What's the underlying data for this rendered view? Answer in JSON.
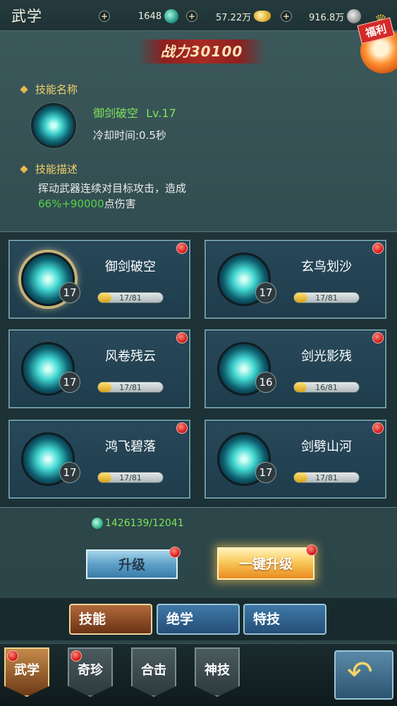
{
  "header": {
    "title": "武学",
    "jade": "1648",
    "gold": "57.22万",
    "coins": "916.8万",
    "welfare": "福利"
  },
  "power": {
    "label": "战力30100"
  },
  "selected_skill": {
    "name_label": "技能名称",
    "name": "御剑破空",
    "level": "Lv.17",
    "cooldown": "冷却时间:0.5秒",
    "desc_label": "技能描述",
    "desc_line1": "挥动武器连续对目标攻击，造成",
    "desc_damage": "66%+90000",
    "desc_suffix": "点伤害"
  },
  "skills": [
    {
      "name": "御剑破空",
      "level": "17",
      "progress": "17/81",
      "progress_value": 0.21
    },
    {
      "name": "玄鸟划沙",
      "level": "17",
      "progress": "17/81",
      "progress_value": 0.21
    },
    {
      "name": "风卷残云",
      "level": "17",
      "progress": "17/81",
      "progress_value": 0.21
    },
    {
      "name": "剑光影残",
      "level": "16",
      "progress": "16/81",
      "progress_value": 0.2
    },
    {
      "name": "鸿飞碧落",
      "level": "17",
      "progress": "17/81",
      "progress_value": 0.21
    },
    {
      "name": "剑劈山河",
      "level": "17",
      "progress": "17/81",
      "progress_value": 0.21
    }
  ],
  "exp": "1426139/12041",
  "buttons": {
    "upgrade": "升级",
    "upgrade_all": "一键升级"
  },
  "subtabs": [
    "技能",
    "绝学",
    "特技"
  ],
  "nav": [
    "武学",
    "奇珍",
    "合击",
    "神技"
  ],
  "colors": {
    "accent_green": "#56d44a",
    "gold": "#f2d36a",
    "alert_red": "#d01414"
  }
}
